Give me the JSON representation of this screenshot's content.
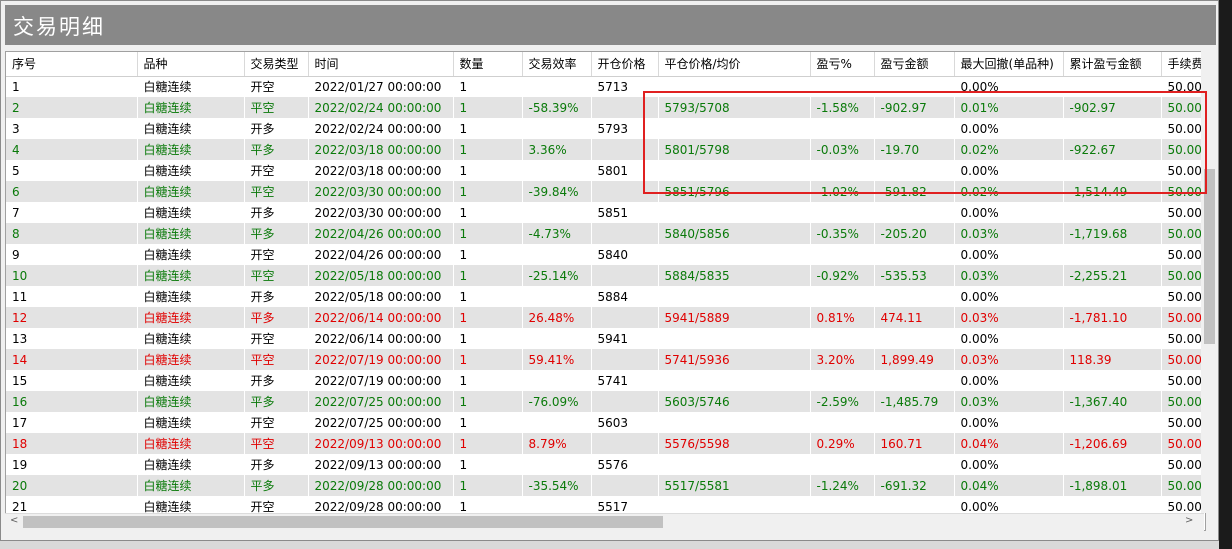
{
  "window": {
    "title": "交易明细"
  },
  "columns": [
    "序号",
    "品种",
    "交易类型",
    "时间",
    "数量",
    "交易效率",
    "开仓价格",
    "平仓价格/均价",
    "盈亏%",
    "盈亏金额",
    "最大回撤(单品种)",
    "累计盈亏金额",
    "手续费"
  ],
  "rows": [
    {
      "color": "black",
      "cells": [
        "1",
        "白糖连续",
        "开空",
        "2022/01/27 00:00:00",
        "1",
        "",
        "5713",
        "",
        "",
        "",
        "0.00%",
        "",
        "50.00"
      ]
    },
    {
      "color": "green",
      "cells": [
        "2",
        "白糖连续",
        "平空",
        "2022/02/24 00:00:00",
        "1",
        "-58.39%",
        "",
        "5793/5708",
        "-1.58%",
        "-902.97",
        "0.01%",
        "-902.97",
        "50.00"
      ]
    },
    {
      "color": "black",
      "cells": [
        "3",
        "白糖连续",
        "开多",
        "2022/02/24 00:00:00",
        "1",
        "",
        "5793",
        "",
        "",
        "",
        "0.00%",
        "",
        "50.00"
      ]
    },
    {
      "color": "green",
      "cells": [
        "4",
        "白糖连续",
        "平多",
        "2022/03/18 00:00:00",
        "1",
        "3.36%",
        "",
        "5801/5798",
        "-0.03%",
        "-19.70",
        "0.02%",
        "-922.67",
        "50.00"
      ]
    },
    {
      "color": "black",
      "cells": [
        "5",
        "白糖连续",
        "开空",
        "2022/03/18 00:00:00",
        "1",
        "",
        "5801",
        "",
        "",
        "",
        "0.00%",
        "",
        "50.00"
      ]
    },
    {
      "color": "green",
      "cells": [
        "6",
        "白糖连续",
        "平空",
        "2022/03/30 00:00:00",
        "1",
        "-39.84%",
        "",
        "5851/5796",
        "-1.02%",
        "-591.82",
        "0.02%",
        "-1,514.49",
        "50.00"
      ]
    },
    {
      "color": "black",
      "cells": [
        "7",
        "白糖连续",
        "开多",
        "2022/03/30 00:00:00",
        "1",
        "",
        "5851",
        "",
        "",
        "",
        "0.00%",
        "",
        "50.00"
      ]
    },
    {
      "color": "green",
      "cells": [
        "8",
        "白糖连续",
        "平多",
        "2022/04/26 00:00:00",
        "1",
        "-4.73%",
        "",
        "5840/5856",
        "-0.35%",
        "-205.20",
        "0.03%",
        "-1,719.68",
        "50.00"
      ]
    },
    {
      "color": "black",
      "cells": [
        "9",
        "白糖连续",
        "开空",
        "2022/04/26 00:00:00",
        "1",
        "",
        "5840",
        "",
        "",
        "",
        "0.00%",
        "",
        "50.00"
      ]
    },
    {
      "color": "green",
      "cells": [
        "10",
        "白糖连续",
        "平空",
        "2022/05/18 00:00:00",
        "1",
        "-25.14%",
        "",
        "5884/5835",
        "-0.92%",
        "-535.53",
        "0.03%",
        "-2,255.21",
        "50.00"
      ]
    },
    {
      "color": "black",
      "cells": [
        "11",
        "白糖连续",
        "开多",
        "2022/05/18 00:00:00",
        "1",
        "",
        "5884",
        "",
        "",
        "",
        "0.00%",
        "",
        "50.00"
      ]
    },
    {
      "color": "red",
      "cells": [
        "12",
        "白糖连续",
        "平多",
        "2022/06/14 00:00:00",
        "1",
        "26.48%",
        "",
        "5941/5889",
        "0.81%",
        "474.11",
        "0.03%",
        "-1,781.10",
        "50.00"
      ]
    },
    {
      "color": "black",
      "cells": [
        "13",
        "白糖连续",
        "开空",
        "2022/06/14 00:00:00",
        "1",
        "",
        "5941",
        "",
        "",
        "",
        "0.00%",
        "",
        "50.00"
      ]
    },
    {
      "color": "red",
      "cells": [
        "14",
        "白糖连续",
        "平空",
        "2022/07/19 00:00:00",
        "1",
        "59.41%",
        "",
        "5741/5936",
        "3.20%",
        "1,899.49",
        "0.03%",
        "118.39",
        "50.00"
      ]
    },
    {
      "color": "black",
      "cells": [
        "15",
        "白糖连续",
        "开多",
        "2022/07/19 00:00:00",
        "1",
        "",
        "5741",
        "",
        "",
        "",
        "0.00%",
        "",
        "50.00"
      ]
    },
    {
      "color": "green",
      "cells": [
        "16",
        "白糖连续",
        "平多",
        "2022/07/25 00:00:00",
        "1",
        "-76.09%",
        "",
        "5603/5746",
        "-2.59%",
        "-1,485.79",
        "0.03%",
        "-1,367.40",
        "50.00"
      ]
    },
    {
      "color": "black",
      "cells": [
        "17",
        "白糖连续",
        "开空",
        "2022/07/25 00:00:00",
        "1",
        "",
        "5603",
        "",
        "",
        "",
        "0.00%",
        "",
        "50.00"
      ]
    },
    {
      "color": "red",
      "cells": [
        "18",
        "白糖连续",
        "平空",
        "2022/09/13 00:00:00",
        "1",
        "8.79%",
        "",
        "5576/5598",
        "0.29%",
        "160.71",
        "0.04%",
        "-1,206.69",
        "50.00"
      ]
    },
    {
      "color": "black",
      "cells": [
        "19",
        "白糖连续",
        "开多",
        "2022/09/13 00:00:00",
        "1",
        "",
        "5576",
        "",
        "",
        "",
        "0.00%",
        "",
        "50.00"
      ]
    },
    {
      "color": "green",
      "cells": [
        "20",
        "白糖连续",
        "平多",
        "2022/09/28 00:00:00",
        "1",
        "-35.54%",
        "",
        "5517/5581",
        "-1.24%",
        "-691.32",
        "0.04%",
        "-1,898.01",
        "50.00"
      ]
    },
    {
      "color": "black",
      "cells": [
        "21",
        "白糖连续",
        "开空",
        "2022/09/28 00:00:00",
        "1",
        "",
        "5517",
        "",
        "",
        "",
        "0.00%",
        "",
        "50.00"
      ]
    }
  ],
  "scrollbar": {
    "left_arrow": "<",
    "right_arrow": ">"
  }
}
